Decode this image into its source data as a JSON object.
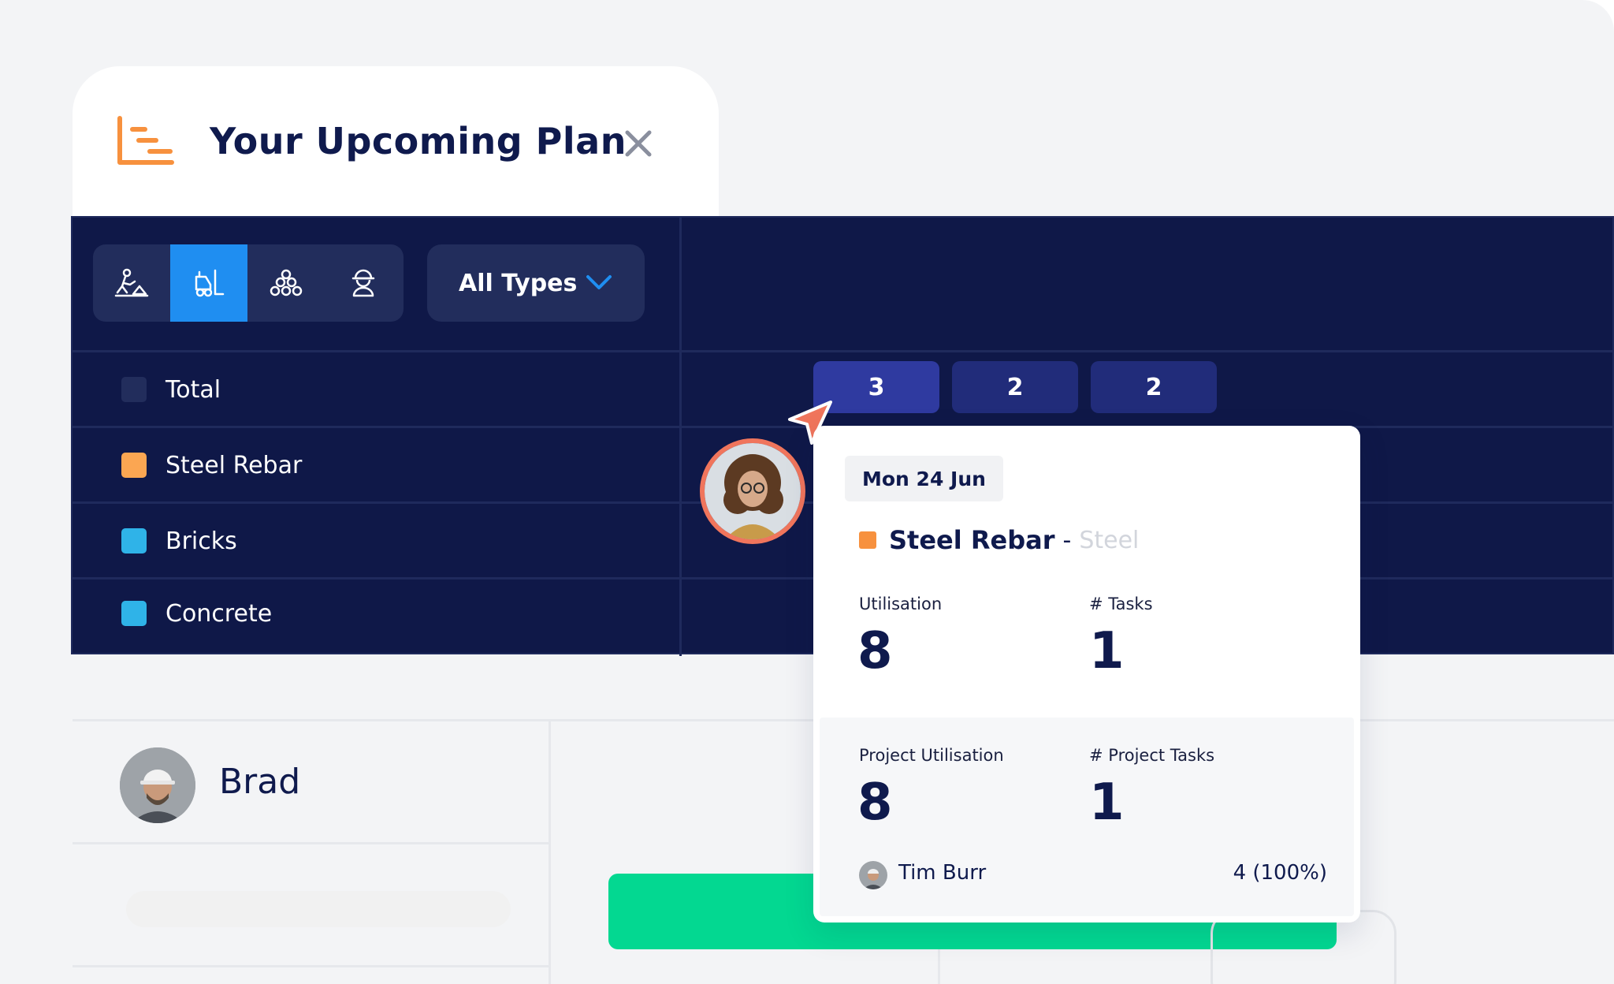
{
  "header": {
    "title": "Your Upcoming Plan",
    "icon": "gantt-plan-icon",
    "close_icon": "close-icon"
  },
  "toolbar": {
    "modes": [
      {
        "icon": "worker-digging-icon",
        "active": false
      },
      {
        "icon": "forklift-icon",
        "active": true
      },
      {
        "icon": "materials-stack-icon",
        "active": false
      },
      {
        "icon": "hardhat-worker-icon",
        "active": false
      }
    ],
    "type_filter": "All Types"
  },
  "rows": [
    {
      "label": "Total",
      "color": "#222d5c"
    },
    {
      "label": "Steel Rebar",
      "color": "#fba652"
    },
    {
      "label": "Bricks",
      "color": "#2fb3e8"
    },
    {
      "label": "Concrete",
      "color": "#2fb3e8"
    }
  ],
  "total_counts": [
    "3",
    "2",
    "2"
  ],
  "tooltip": {
    "date": "Mon 24 Jun",
    "resource": "Steel Rebar",
    "separator": "-",
    "category": "Steel",
    "resource_color": "#f7913e",
    "utilisation_label": "Utilisation",
    "utilisation_value": "8",
    "tasks_label": "# Tasks",
    "tasks_value": "1",
    "project_utilisation_label": "Project Utilisation",
    "project_utilisation_value": "8",
    "project_tasks_label": "# Project Tasks",
    "project_tasks_value": "1",
    "person_name": "Tim Burr",
    "person_value": "4 (100%)"
  },
  "schedule": {
    "person": "Brad",
    "bar_color": "#03d891"
  },
  "colors": {
    "navy": "#0f1848",
    "accent_blue": "#1f8ef1",
    "orange": "#f7913e",
    "coral": "#f0755c"
  }
}
